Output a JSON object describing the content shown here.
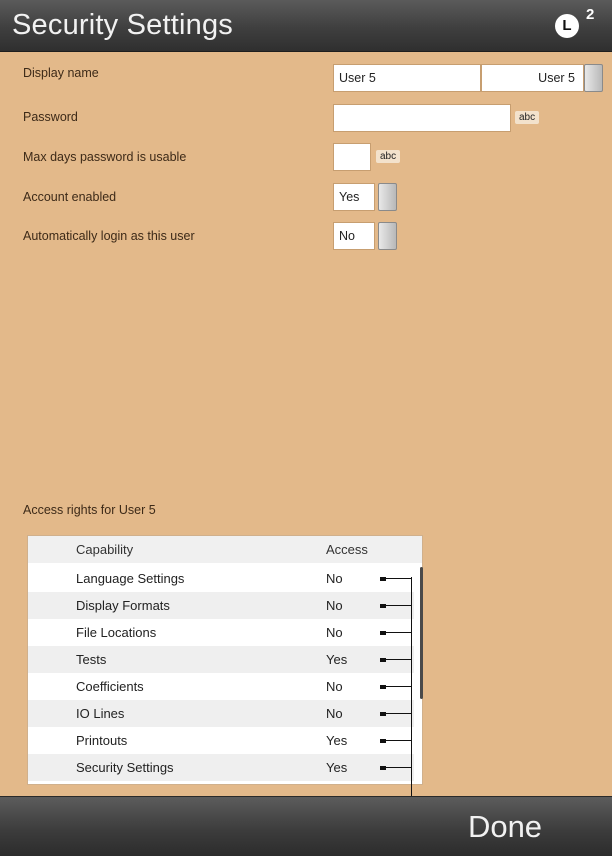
{
  "header": {
    "title": "Security Settings",
    "level_badge": "L",
    "level_number": "2"
  },
  "settings": {
    "display_name": {
      "label": "Display name",
      "value": "User 5",
      "selector_value": "User 5"
    },
    "password": {
      "label": "Password",
      "value": "",
      "keyboard_hint": "abc"
    },
    "max_days": {
      "label": "Max days password is usable",
      "value": "",
      "keyboard_hint": "abc"
    },
    "account_enabled": {
      "label": "Account enabled",
      "value": "Yes"
    },
    "auto_login": {
      "label": "Automatically login as this user",
      "value": "No"
    }
  },
  "access": {
    "title": "Access rights for User 5",
    "columns": [
      "Capability",
      "Access"
    ],
    "rows": [
      {
        "capability": "Language Settings",
        "access": "No"
      },
      {
        "capability": "Display Formats",
        "access": "No"
      },
      {
        "capability": "File Locations",
        "access": "No"
      },
      {
        "capability": "Tests",
        "access": "Yes"
      },
      {
        "capability": "Coefficients",
        "access": "No"
      },
      {
        "capability": "IO Lines",
        "access": "No"
      },
      {
        "capability": "Printouts",
        "access": "Yes"
      },
      {
        "capability": "Security Settings",
        "access": "Yes"
      }
    ]
  },
  "footer": {
    "done_label": "Done"
  },
  "colors": {
    "background": "#e3b98a",
    "header_bar": "#3f3f3f",
    "footer_bar": "#3d3d3d",
    "table_bg": "#ffffff",
    "table_alt_row": "#efefef"
  },
  "icons": [
    "level-badge-icon",
    "spin-button-icon",
    "row-handle-icon"
  ]
}
